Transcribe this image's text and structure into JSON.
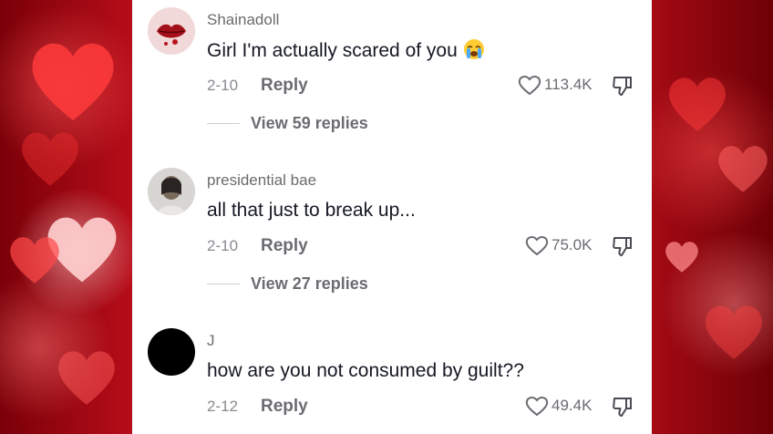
{
  "colors": {
    "background_red": "#c8101c",
    "panel": "#ffffff",
    "text_primary": "#161823",
    "text_secondary": "#6b6c72"
  },
  "comments": [
    {
      "username": "Shainadoll",
      "text": "Girl I'm actually scared of you",
      "emoji": "loudly-crying-face-icon",
      "date": "2-10",
      "reply_label": "Reply",
      "likes": "113.4K",
      "view_replies": "View 59 replies",
      "avatar": "red-lips-avatar"
    },
    {
      "username": "presidential bae",
      "text": "all that just to break up...",
      "date": "2-10",
      "reply_label": "Reply",
      "likes": "75.0K",
      "view_replies": "View 27 replies",
      "avatar": "photo-avatar"
    },
    {
      "username": "J",
      "text": "how are you not consumed by guilt??",
      "date": "2-12",
      "reply_label": "Reply",
      "likes": "49.4K",
      "avatar": "black-avatar"
    }
  ]
}
